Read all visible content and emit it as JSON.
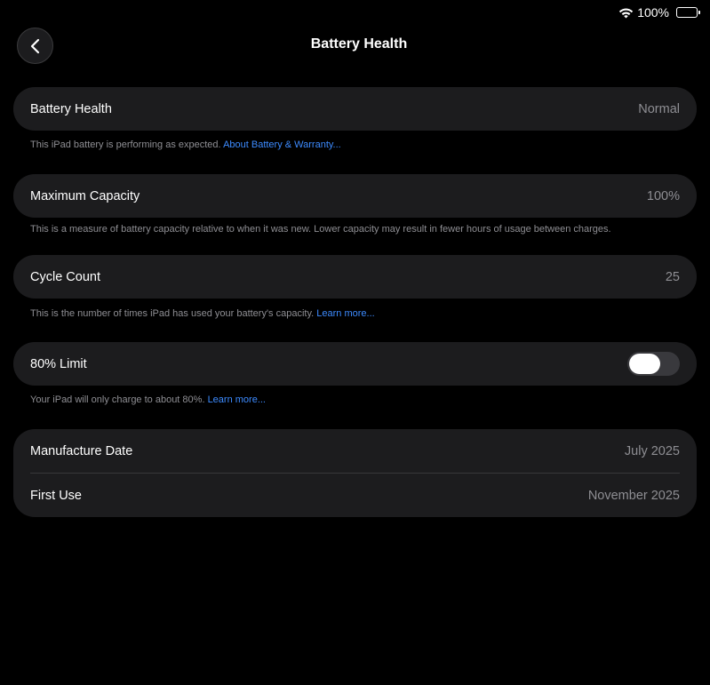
{
  "status_bar": {
    "battery_percent": "100%",
    "battery_level": 1.0
  },
  "nav": {
    "title": "Battery Health"
  },
  "battery_health": {
    "label": "Battery Health",
    "value": "Normal",
    "footnote": "This iPad battery is performing as expected.",
    "footnote_link": "About Battery & Warranty..."
  },
  "maximum_capacity": {
    "label": "Maximum Capacity",
    "value": "100%",
    "footnote": "This is a measure of battery capacity relative to when it was new. Lower capacity may result in fewer hours of usage between charges."
  },
  "cycle_count": {
    "label": "Cycle Count",
    "value": "25",
    "footnote": "This is the number of times iPad has used your battery's capacity.",
    "footnote_link": "Learn more..."
  },
  "limit": {
    "label": "80% Limit",
    "enabled": false,
    "footnote": "Your iPad will only charge to about 80%.",
    "footnote_link": "Learn more..."
  },
  "dates": {
    "manufacture_label": "Manufacture Date",
    "manufacture_value": "July 2025",
    "first_use_label": "First Use",
    "first_use_value": "November 2025"
  },
  "colors": {
    "background": "#000000",
    "card": "#1c1c1e",
    "secondary_text": "#8e8e93",
    "link": "#3d8bff"
  }
}
